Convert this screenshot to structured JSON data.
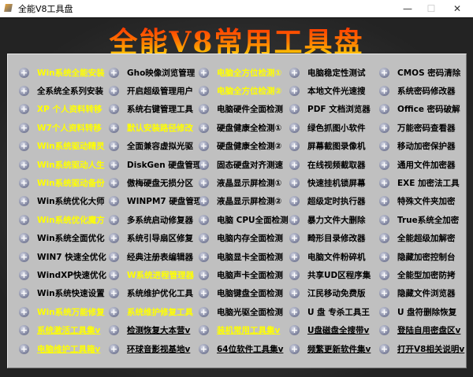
{
  "window": {
    "title": "全能V8工具盘",
    "minimize": "—",
    "maximize": "☐",
    "close": "✕"
  },
  "banner": "全能V8常用工具盘",
  "colors": {
    "highlight": "#ffff00",
    "normal": "#000000",
    "panel": "#c0c0c0"
  },
  "columns": [
    [
      {
        "label": "Win系统全能安装",
        "yellow": true
      },
      {
        "label": "全系统全系列安装"
      },
      {
        "label": "XP 个人资料转移",
        "yellow": true
      },
      {
        "label": "W7个人资料转移",
        "yellow": true
      },
      {
        "label": "Win系统驱动精灵",
        "yellow": true
      },
      {
        "label": "Win系统驱动人生",
        "yellow": true
      },
      {
        "label": "Win系统驱动备份",
        "yellow": true
      },
      {
        "label": "Win系统优化大师"
      },
      {
        "label": "Win系统优化魔方",
        "yellow": true
      },
      {
        "label": "Win系统全面优化"
      },
      {
        "label": "WIN7 快速全优化"
      },
      {
        "label": "WindXP快速优化"
      },
      {
        "label": "Win系统快速设置"
      },
      {
        "label": "Win系统万能修复",
        "yellow": true
      },
      {
        "label": "系统激活工具集v",
        "yellow": true,
        "underline": true
      },
      {
        "label": "电脑维护工具箱v",
        "yellow": true,
        "underline": true
      }
    ],
    [
      {
        "label": "Gho映像浏览管理"
      },
      {
        "label": "开启超级管理用户"
      },
      {
        "label": "系统右键管理工具"
      },
      {
        "label": "默认安装路径修改",
        "yellow": true
      },
      {
        "label": "全面兼容虚拟光驱"
      },
      {
        "label": "DiskGen 硬盘管理"
      },
      {
        "label": "傲梅硬盘无损分区"
      },
      {
        "label": "WINPM7 硬盘管理"
      },
      {
        "label": "多系统启动修复器"
      },
      {
        "label": "系统引导扇区修复"
      },
      {
        "label": "经典注册表编辑器"
      },
      {
        "label": "W系统进程管理器",
        "yellow": true
      },
      {
        "label": "系统维护优化工具"
      },
      {
        "label": "系统维护修复工具",
        "yellow": true
      },
      {
        "label": "检测恢复大本营v",
        "underline": true
      },
      {
        "label": "环球音影视基地v",
        "underline": true
      }
    ],
    [
      {
        "label": "电脑全方位检测①",
        "yellow": true
      },
      {
        "label": "电脑全方位检测②",
        "yellow": true
      },
      {
        "label": "电脑硬件全面检测"
      },
      {
        "label": "硬盘健康全检测①"
      },
      {
        "label": "硬盘健康全检测②"
      },
      {
        "label": "固态硬盘对齐测速"
      },
      {
        "label": "液晶显示屏检测①"
      },
      {
        "label": "液晶显示屏检测②"
      },
      {
        "label": "电脑 CPU全面检测"
      },
      {
        "label": "电脑内存全面检测"
      },
      {
        "label": "电脑显卡全面检测"
      },
      {
        "label": "电脑声卡全面检测"
      },
      {
        "label": "电脑键盘全面检测"
      },
      {
        "label": "电脑光驱全面检测"
      },
      {
        "label": "装机常用工具集v",
        "yellow": true,
        "underline": true
      },
      {
        "label": "64位软件工具集v",
        "underline": true
      }
    ],
    [
      {
        "label": "电脑稳定性测试"
      },
      {
        "label": "本地文件光速搜"
      },
      {
        "label": "PDF 文档浏览器"
      },
      {
        "label": "绿色抓图小软件"
      },
      {
        "label": "屏幕截图录像机"
      },
      {
        "label": "在线视频截取器"
      },
      {
        "label": "快速挂机锁屏幕"
      },
      {
        "label": "超级定时执行器"
      },
      {
        "label": "暴力文件大删除"
      },
      {
        "label": "畸形目录修改器"
      },
      {
        "label": "电脑文件粉碎机"
      },
      {
        "label": "共享UD区程序集"
      },
      {
        "label": "江民移动免费版"
      },
      {
        "label": "U 盘 专杀工具王"
      },
      {
        "label": "U盘磁盘全搜带v",
        "underline": true
      },
      {
        "label": "频繁更新软件集v",
        "underline": true
      }
    ],
    [
      {
        "label": "CMOS 密码清除"
      },
      {
        "label": "系统密码修改器"
      },
      {
        "label": "Office 密码破解"
      },
      {
        "label": "万能密码查看器"
      },
      {
        "label": "移动加密保护器"
      },
      {
        "label": "通用文件加密器"
      },
      {
        "label": "EXE 加密法工具"
      },
      {
        "label": "特殊文件夹加密"
      },
      {
        "label": "True系统全加密"
      },
      {
        "label": "全能超级加解密"
      },
      {
        "label": "隐藏加密控制台"
      },
      {
        "label": "全能型加密防拷"
      },
      {
        "label": "隐藏文件浏览器"
      },
      {
        "label": "U 盘符删除恢复"
      },
      {
        "label": "登陆自用密盘区v",
        "underline": true
      },
      {
        "label": "打开V8相关说明v",
        "underline": true
      }
    ]
  ]
}
